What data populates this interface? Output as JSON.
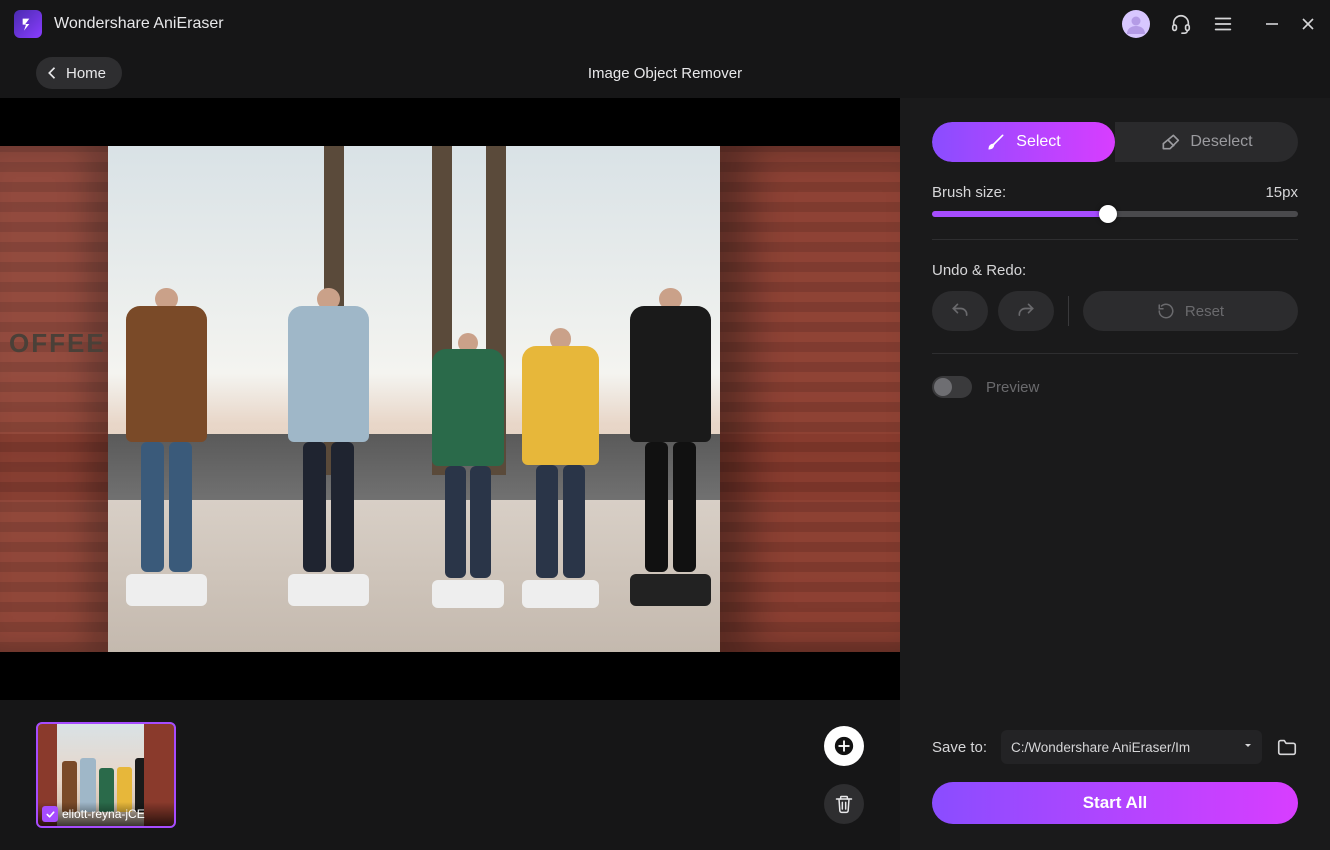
{
  "app": {
    "title": "Wondershare AniEraser"
  },
  "nav": {
    "home": "Home",
    "page_title": "Image Object Remover"
  },
  "panel": {
    "select_label": "Select",
    "deselect_label": "Deselect",
    "brush_label": "Brush size:",
    "brush_value": "15px",
    "brush_percent": 48,
    "undo_redo_label": "Undo & Redo:",
    "reset_label": "Reset",
    "preview_label": "Preview",
    "save_label": "Save to:",
    "save_path": "C:/Wondershare AniEraser/Im",
    "start_label": "Start All"
  },
  "thumbs": {
    "items": [
      {
        "filename": "eliott-reyna-jCE",
        "selected": true
      }
    ]
  },
  "scene": {
    "sign": "OFFEE"
  }
}
